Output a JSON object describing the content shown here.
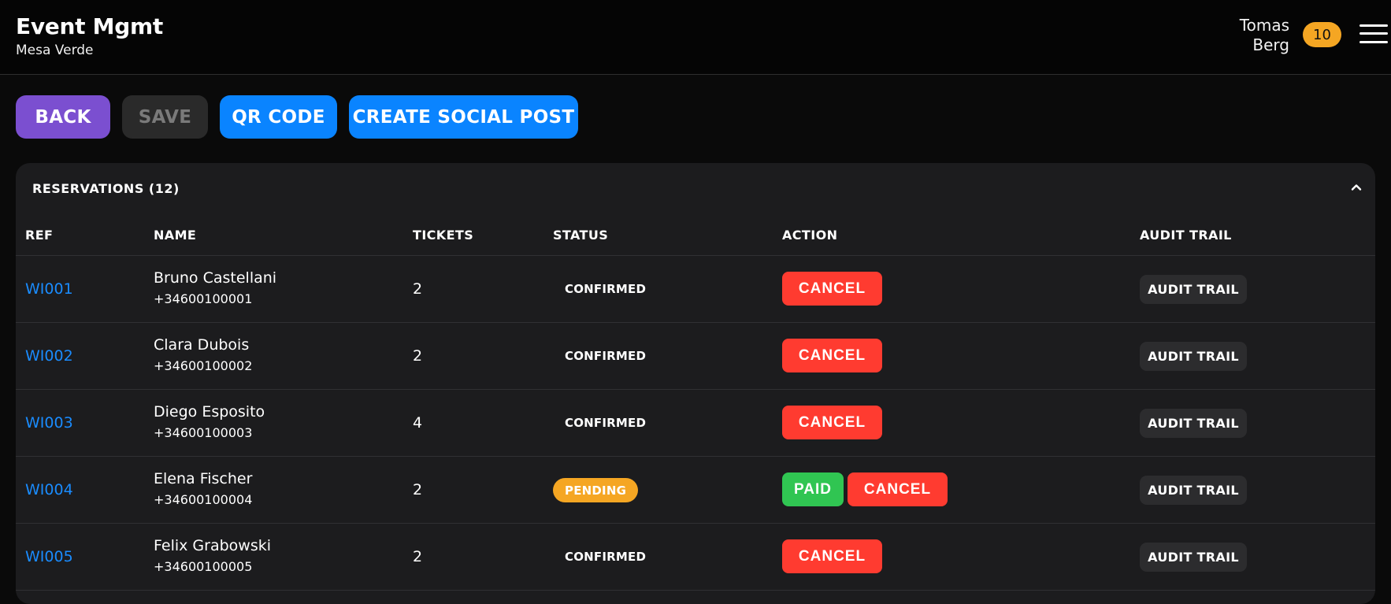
{
  "header": {
    "title": "Event Mgmt",
    "subtitle": "Mesa Verde",
    "user_first": "Tomas",
    "user_last": "Berg",
    "badge_count": "10"
  },
  "toolbar": {
    "back_label": "BACK",
    "save_label": "SAVE",
    "qr_label": "QR CODE",
    "social_label": "CREATE SOCIAL POST"
  },
  "reservations": {
    "title": "RESERVATIONS (12)",
    "columns": [
      "REF",
      "NAME",
      "TICKETS",
      "STATUS",
      "ACTION",
      "AUDIT TRAIL"
    ],
    "rows": [
      {
        "ref": "WI001",
        "name": "Bruno Castellani",
        "phone": "+34600100001",
        "tickets": "2",
        "status": "CONFIRMED",
        "paid": "",
        "cancel": "CANCEL",
        "audit": "AUDIT TRAIL"
      },
      {
        "ref": "WI002",
        "name": "Clara Dubois",
        "phone": "+34600100002",
        "tickets": "2",
        "status": "CONFIRMED",
        "paid": "",
        "cancel": "CANCEL",
        "audit": "AUDIT TRAIL"
      },
      {
        "ref": "WI003",
        "name": "Diego Esposito",
        "phone": "+34600100003",
        "tickets": "4",
        "status": "CONFIRMED",
        "paid": "",
        "cancel": "CANCEL",
        "audit": "AUDIT TRAIL"
      },
      {
        "ref": "WI004",
        "name": "Elena Fischer",
        "phone": "+34600100004",
        "tickets": "2",
        "status": "PENDING",
        "paid": "PAID",
        "cancel": "CANCEL",
        "audit": "AUDIT TRAIL"
      },
      {
        "ref": "WI005",
        "name": "Felix Grabowski",
        "phone": "+34600100005",
        "tickets": "2",
        "status": "CONFIRMED",
        "paid": "",
        "cancel": "CANCEL",
        "audit": "AUDIT TRAIL"
      }
    ]
  },
  "icons": {
    "menu": "hamburger-menu-icon",
    "collapse": "chevron-up-icon"
  },
  "colors": {
    "back": "#7b4fd0",
    "primary": "#0a84ff",
    "cancel": "#ff3b30",
    "paid": "#30c552",
    "pending": "#f5a623",
    "link": "#1a8cff"
  }
}
